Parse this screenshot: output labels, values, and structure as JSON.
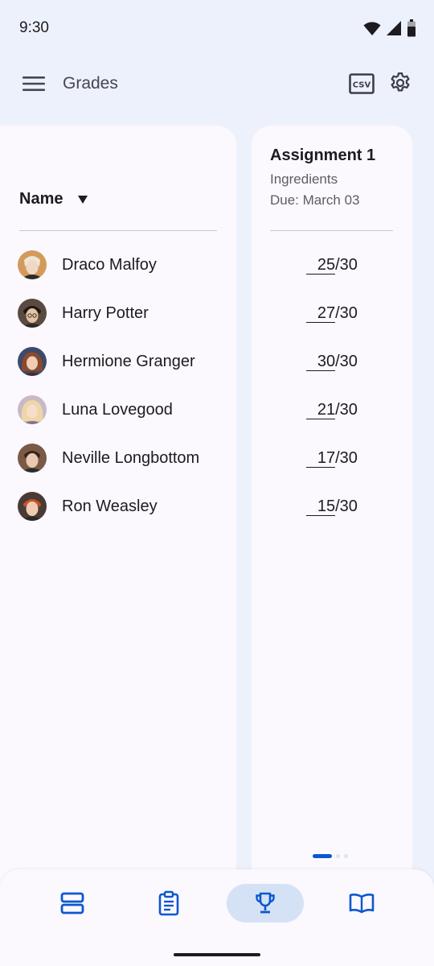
{
  "status_bar": {
    "time": "9:30"
  },
  "app_bar": {
    "title": "Grades",
    "menu_icon": "menu-icon",
    "csv_icon": "csv-icon",
    "settings_icon": "gear-icon"
  },
  "table": {
    "name_header": "Name",
    "sort_icon": "sort-down-icon",
    "students": [
      {
        "name": "Draco Malfoy",
        "avatar_color": "#C9A074"
      },
      {
        "name": "Harry Potter",
        "avatar_color": "#4A3A32"
      },
      {
        "name": "Hermione Granger",
        "avatar_color": "#8A4B33"
      },
      {
        "name": "Luna Lovegood",
        "avatar_color": "#E2C49A"
      },
      {
        "name": "Neville Longbottom",
        "avatar_color": "#6B4A38"
      },
      {
        "name": "Ron Weasley",
        "avatar_color": "#B4532C"
      }
    ]
  },
  "assignment": {
    "title": "Assignment 1",
    "subtitle": "Ingredients",
    "due": "Due: March 03",
    "max_label": "/30",
    "grades": [
      "25",
      "27",
      "30",
      "21",
      "17",
      "15"
    ]
  },
  "pagination": {
    "pages": 3,
    "current": 1
  },
  "bottom_nav": {
    "items": [
      {
        "icon": "stream-icon",
        "active": false
      },
      {
        "icon": "clipboard-icon",
        "active": false
      },
      {
        "icon": "trophy-icon",
        "active": true
      },
      {
        "icon": "book-icon",
        "active": false
      }
    ]
  },
  "colors": {
    "accent": "#0B57D0",
    "background": "#EDF1FB",
    "surface": "#FBF8FE",
    "active_pill": "#D5E2F6"
  }
}
